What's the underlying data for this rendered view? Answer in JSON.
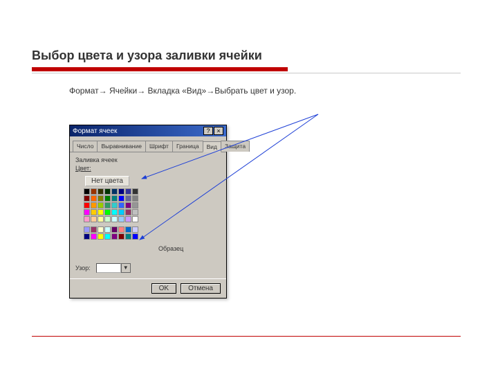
{
  "slide": {
    "title": "Выбор цвета и узора заливки ячейки",
    "instruction": "Формат→ Ячейки→ Вкладка «Вид»→Выбрать цвет и узор."
  },
  "dialog": {
    "title": "Формат ячеек",
    "help": "?",
    "close": "×",
    "tabs": [
      "Число",
      "Выравнивание",
      "Шрифт",
      "Граница",
      "Вид",
      "Защита"
    ],
    "active_tab": "Вид",
    "group_label": "Заливка ячеек",
    "color_label": "Цвет:",
    "no_color": "Нет цвета",
    "sample_label": "Образец",
    "pattern_label": "Узор:",
    "ok": "OK",
    "cancel": "Отмена",
    "palette_main": [
      [
        "#000000",
        "#993300",
        "#333300",
        "#003300",
        "#003366",
        "#000080",
        "#333399",
        "#333333"
      ],
      [
        "#800000",
        "#ff6600",
        "#808000",
        "#008000",
        "#008080",
        "#0000ff",
        "#666699",
        "#808080"
      ],
      [
        "#ff0000",
        "#ff9900",
        "#99cc00",
        "#339966",
        "#33cccc",
        "#3366ff",
        "#800080",
        "#969696"
      ],
      [
        "#ff00ff",
        "#ffcc00",
        "#ffff00",
        "#00ff00",
        "#00ffff",
        "#00ccff",
        "#993366",
        "#c0c0c0"
      ],
      [
        "#ff99cc",
        "#ffcc99",
        "#ffff99",
        "#ccffcc",
        "#ccffff",
        "#99ccff",
        "#cc99ff",
        "#ffffff"
      ]
    ],
    "palette_extra": [
      [
        "#9999ff",
        "#993366",
        "#ffffcc",
        "#ccffff",
        "#660066",
        "#ff8080",
        "#0066cc",
        "#ccccff"
      ],
      [
        "#000080",
        "#ff00ff",
        "#ffff00",
        "#00ffff",
        "#800080",
        "#800000",
        "#008080",
        "#0000ff"
      ]
    ]
  }
}
